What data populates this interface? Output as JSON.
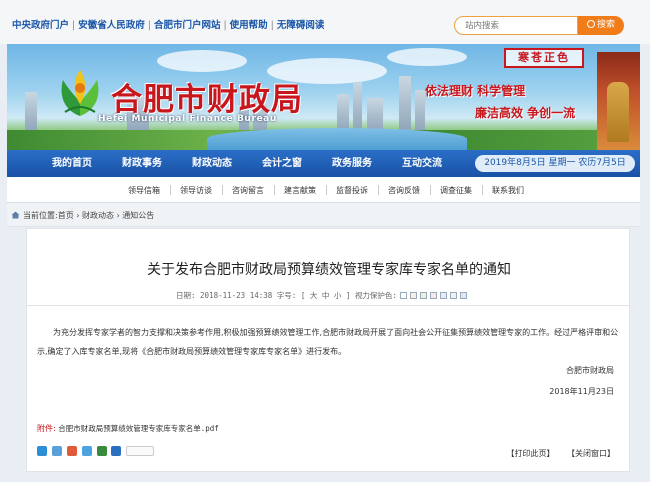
{
  "top_links": [
    "中央政府门户",
    "安徽省人民政府",
    "合肥市门户网站",
    "使用帮助",
    "无障碍阅读"
  ],
  "search": {
    "placeholder": "站内搜索",
    "button_label": "搜索"
  },
  "banner": {
    "title": "合肥市财政局",
    "subtitle": "Hefei Municipal Finance Bureau",
    "slogan_line1": "依法理财 科学管理",
    "slogan_line2": "廉洁高效 争创一流",
    "seal_text": "寒苍正色"
  },
  "nav": {
    "items": [
      "我的首页",
      "财政事务",
      "财政动态",
      "会计之窗",
      "政务服务",
      "互动交流"
    ],
    "date": "2019年8月5日 星期一 农历7月5日"
  },
  "subnav": {
    "items": [
      "领导信箱",
      "领导访谈",
      "咨询留言",
      "建言献策",
      "监督投诉",
      "咨询反馈",
      "调查征集",
      "联系我们"
    ]
  },
  "breadcrumb": {
    "label": "当前位置:",
    "items": [
      "首页",
      "财政动态",
      "通知公告"
    ]
  },
  "article": {
    "title": "关于发布合肥市财政局预算绩效管理专家库专家名单的通知",
    "meta_date": "日期: 2018-11-23 14:38",
    "meta_fontsize": "字号: [ 大 中 小 ]",
    "meta_eye": "视力保护色:",
    "eye_colors": [
      "#ffffff",
      "#f5f0e0",
      "#e9f2e1",
      "#f9e6ec",
      "#e5eaf5",
      "#eef0f5",
      "#dfe6f5"
    ],
    "paragraph": "为充分发挥专家学者的智力支撑和决策参考作用,积极加强预算绩效管理工作,合肥市财政局开展了面向社会公开征集预算绩效管理专家的工作。经过严格评审和公示,确定了入库专家名单,现将《合肥市财政局预算绩效管理专家库专家名单》进行发布。",
    "signature": "合肥市财政局",
    "sign_date": "2018年11月23日",
    "attachment_label": "附件:",
    "attachment_file": "合肥市财政局预算绩效管理专家库专家名单.pdf",
    "print_label": "【打印此页】",
    "close_label": "【关闭窗口】"
  },
  "colors": {
    "brand_red": "#c8161d",
    "nav_blue": "#1f5fb5",
    "accent_orange": "#f07d1a"
  }
}
